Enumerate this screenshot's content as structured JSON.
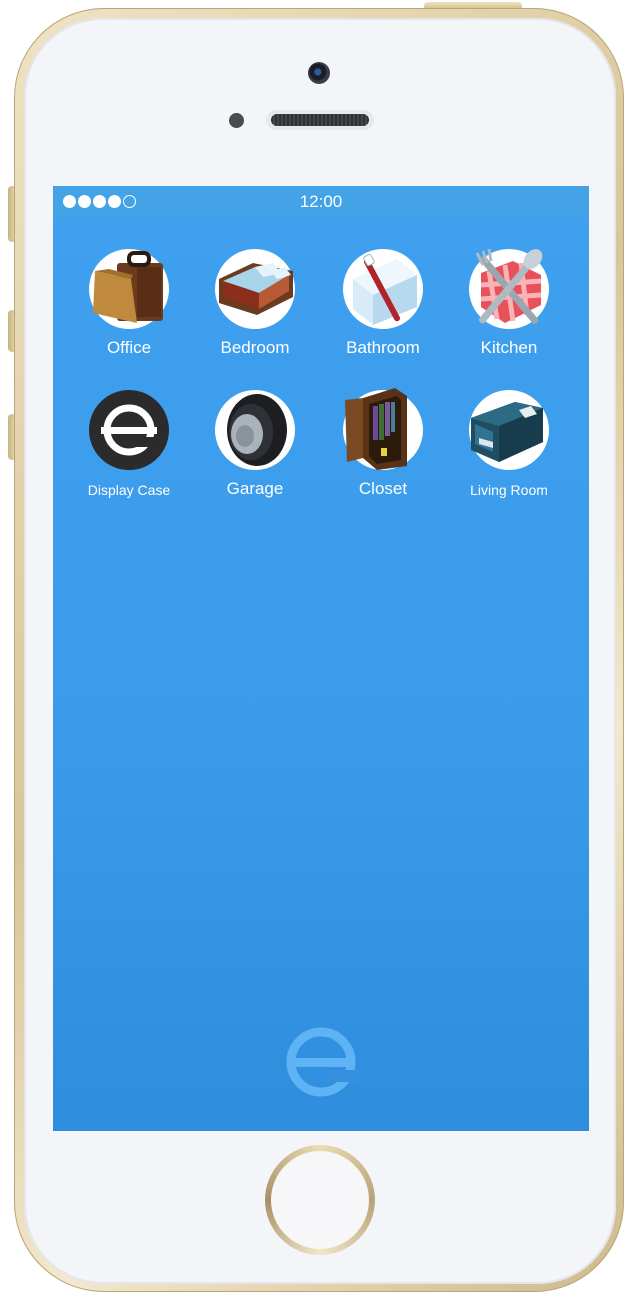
{
  "status_bar": {
    "signal_bars_filled": 4,
    "signal_bars_total": 5,
    "time": "12:00"
  },
  "apps": [
    {
      "label": "Office",
      "icon": "briefcase-folder-icon"
    },
    {
      "label": "Bedroom",
      "icon": "bed-icon"
    },
    {
      "label": "Bathroom",
      "icon": "toothbrush-towel-icon"
    },
    {
      "label": "Kitchen",
      "icon": "fork-spoon-icon"
    },
    {
      "label": "Display Case",
      "icon": "e-logo-icon"
    },
    {
      "label": "Garage",
      "icon": "tire-icon"
    },
    {
      "label": "Closet",
      "icon": "wardrobe-icon"
    },
    {
      "label": "Living Room",
      "icon": "sofa-icon"
    }
  ],
  "colors": {
    "screen_top": "#3ea0ee",
    "screen_bottom": "#2e8ddc",
    "status_bar": "#44a3e6",
    "frame_gold": "#d9c698"
  }
}
